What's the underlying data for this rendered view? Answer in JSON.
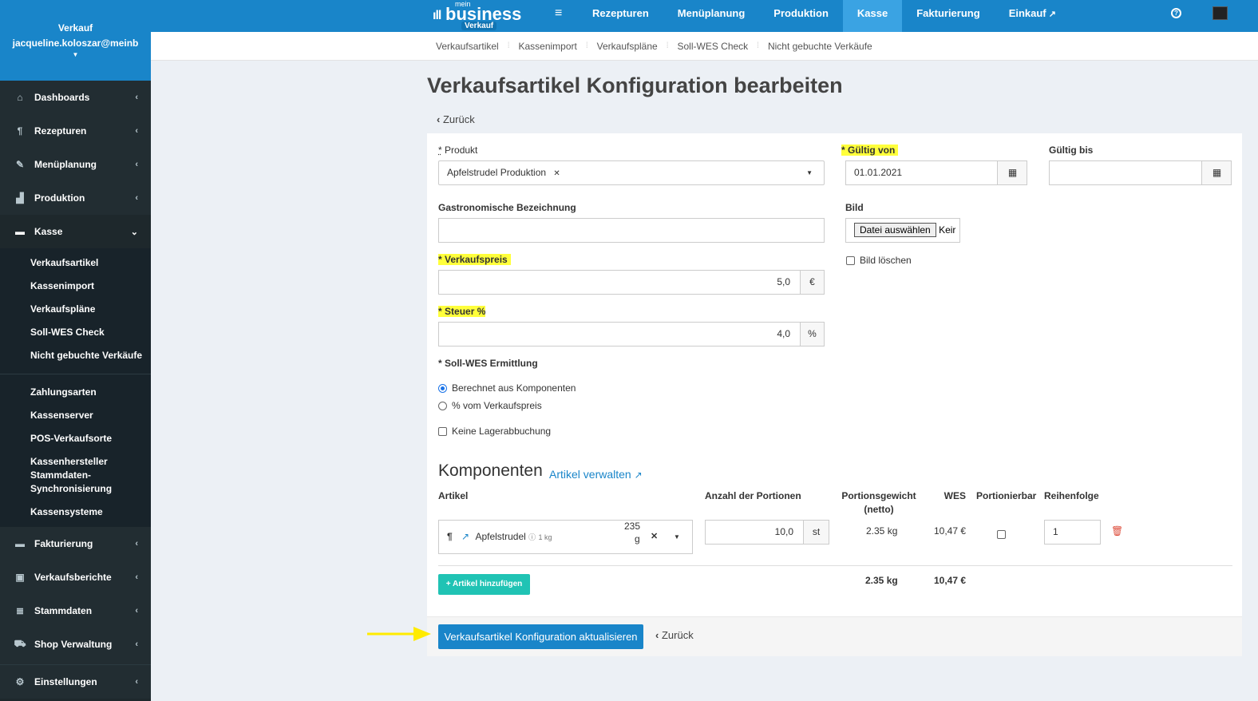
{
  "sidebar": {
    "user_role": "Verkauf",
    "user_email": "jacqueline.koloszar@meinb",
    "items": [
      {
        "label": "Dashboards",
        "icon": "home-icon"
      },
      {
        "label": "Rezepturen",
        "icon": "cutlery-icon"
      },
      {
        "label": "Menüplanung",
        "icon": "edit-icon"
      },
      {
        "label": "Produktion",
        "icon": "bar-chart-icon"
      },
      {
        "label": "Kasse",
        "icon": "credit-card-icon"
      }
    ],
    "kasse_sub": [
      "Verkaufsartikel",
      "Kassenimport",
      "Verkaufspläne",
      "Soll-WES Check",
      "Nicht gebuchte Verkäufe"
    ],
    "kasse_sub2": [
      "Zahlungsarten",
      "Kassenserver",
      "POS-Verkaufsorte",
      "Kassenhersteller Stammdaten-Synchronisierung",
      "Kassensysteme"
    ],
    "items_bottom": [
      {
        "label": "Fakturierung",
        "icon": "credit-card-icon"
      },
      {
        "label": "Verkaufsberichte",
        "icon": "money-icon"
      },
      {
        "label": "Stammdaten",
        "icon": "database-icon"
      },
      {
        "label": "Shop Verwaltung",
        "icon": "car-icon"
      },
      {
        "label": "Einstellungen",
        "icon": "gear-icon"
      }
    ]
  },
  "topbar": {
    "logo_mein": "mein",
    "logo_business": "business",
    "logo_badge": "Verkauf",
    "nav": [
      "Rezepturen",
      "Menüplanung",
      "Produktion",
      "Kasse",
      "Fakturierung",
      "Einkauf"
    ],
    "active": "Kasse"
  },
  "subnav": [
    "Verkaufsartikel",
    "Kassenimport",
    "Verkaufspläne",
    "Soll-WES Check",
    "Nicht gebuchte Verkäufe"
  ],
  "page": {
    "title": "Verkaufsartikel Konfiguration bearbeiten",
    "back": "Zurück"
  },
  "form": {
    "produkt_label": "Produkt",
    "produkt_value": "Apfelstrudel Produktion",
    "gueltig_von_label": "Gültig von",
    "gueltig_von_value": "01.01.2021",
    "gueltig_bis_label": "Gültig bis",
    "gueltig_bis_value": "",
    "gastro_label": "Gastronomische Bezeichnung",
    "gastro_value": "",
    "bild_label": "Bild",
    "file_button": "Datei auswählen",
    "file_status": "Keir",
    "bild_loeschen": "Bild löschen",
    "verkaufspreis_label": "Verkaufspreis",
    "verkaufspreis_value": "5,0",
    "currency": "€",
    "steuer_label": "Steuer %",
    "steuer_value": "4,0",
    "percent": "%",
    "sollwes_label": "Soll-WES Ermittlung",
    "radio_1": "Berechnet aus Komponenten",
    "radio_2": "% vom Verkaufspreis",
    "keine_lager": "Keine Lagerabbuchung",
    "required_mark": "*"
  },
  "komponenten": {
    "title": "Komponenten",
    "manage_link": "Artikel verwalten",
    "headers": {
      "artikel": "Artikel",
      "anzahl": "Anzahl der Portionen",
      "gewicht_1": "Portionsgewicht",
      "gewicht_2": "(netto)",
      "wes": "WES",
      "portionierbar": "Portionierbar",
      "reihenfolge": "Reihenfolge"
    },
    "row": {
      "name": "Apfelstrudel",
      "unit_info": "1 kg",
      "qty_top": "235",
      "qty_bottom": "g",
      "portions": "10,0",
      "portions_unit": "st",
      "weight": "2.35 kg",
      "wes": "10,47 €",
      "order": "1"
    },
    "totals": {
      "weight": "2.35 kg",
      "wes": "10,47 €"
    },
    "add_button": "Artikel hinzufügen"
  },
  "footer": {
    "submit": "Verkaufsartikel Konfiguration aktualisieren",
    "back": "Zurück"
  },
  "colors": {
    "brand": "#1985c9",
    "highlight": "#ffff3b",
    "add": "#20c3b4",
    "arrow": "#ffeb00"
  }
}
